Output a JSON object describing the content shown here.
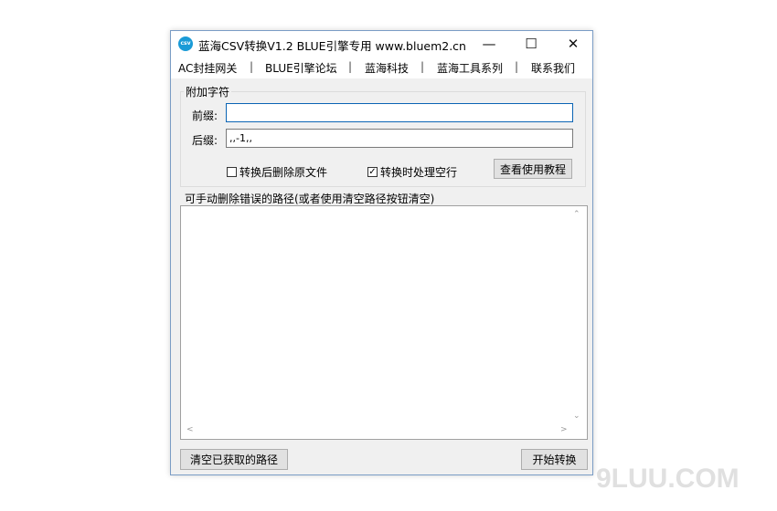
{
  "window": {
    "title": "蓝海CSV转换V1.2  BLUE引擎专用 www.bluem2.cn",
    "icon_text": "csv",
    "icon_color": "#1a9bd7",
    "controls": {
      "minimize": "—",
      "maximize": "☐",
      "close": "✕"
    }
  },
  "menu": {
    "items": [
      "AC封挂网关",
      "BLUE引擎论坛",
      "蓝海科技",
      "蓝海工具系列",
      "联系我们"
    ],
    "separator": "|"
  },
  "affix_group": {
    "title": "附加字符",
    "prefix_label": "前缀:",
    "prefix_value": "",
    "suffix_label": "后缀:",
    "suffix_value": ",,-1,,"
  },
  "options": {
    "delete_after_convert_label": "转换后删除原文件",
    "delete_after_convert_checked": false,
    "handle_empty_lines_label": "转换时处理空行",
    "handle_empty_lines_checked": true,
    "tutorial_button": "查看使用教程"
  },
  "path_list": {
    "label": "可手动删除错误的路径(或者使用清空路径按钮清空)",
    "items": []
  },
  "footer": {
    "clear_button": "清空已获取的路径",
    "start_button": "开始转换"
  },
  "watermark": "9LUU.COM"
}
